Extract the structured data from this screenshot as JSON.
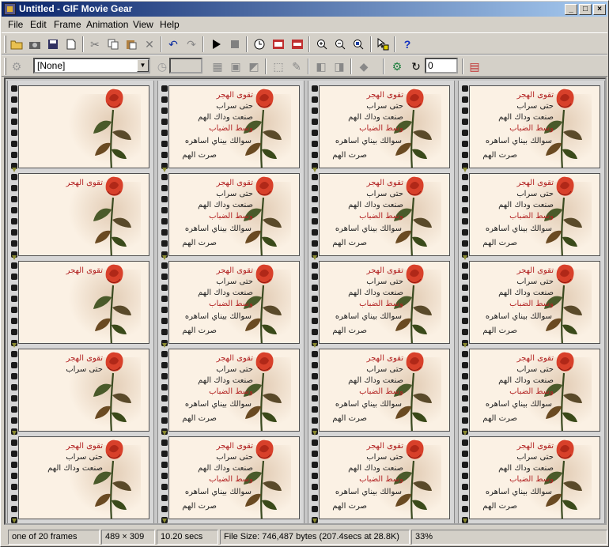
{
  "window": {
    "title": "Untitled - GIF Movie Gear"
  },
  "menu": [
    "File",
    "Edit",
    "Frame",
    "Animation",
    "View",
    "Help"
  ],
  "toolbar2": {
    "effect_value": "[None]",
    "delay_value": "",
    "loop_value": "0"
  },
  "frame_texts": {
    "l1": "تقوى الهجر",
    "l2": "حتى سراب",
    "l3": "صنعت وداك الهم",
    "l4": "وسط الضباب",
    "l5": "سوالك بيناي اساهره",
    "l6": "صرت الهم"
  },
  "status": {
    "frames": "one of 20 frames",
    "dimensions": "489 × 309",
    "duration": "10.20 secs",
    "filesize": "File Size: 746,487 bytes  (207.4secs at 28.8K)",
    "zoom": "33%"
  },
  "colors": {
    "title_start": "#0a246a",
    "title_end": "#a6caf0",
    "text_red": "#b22222"
  }
}
